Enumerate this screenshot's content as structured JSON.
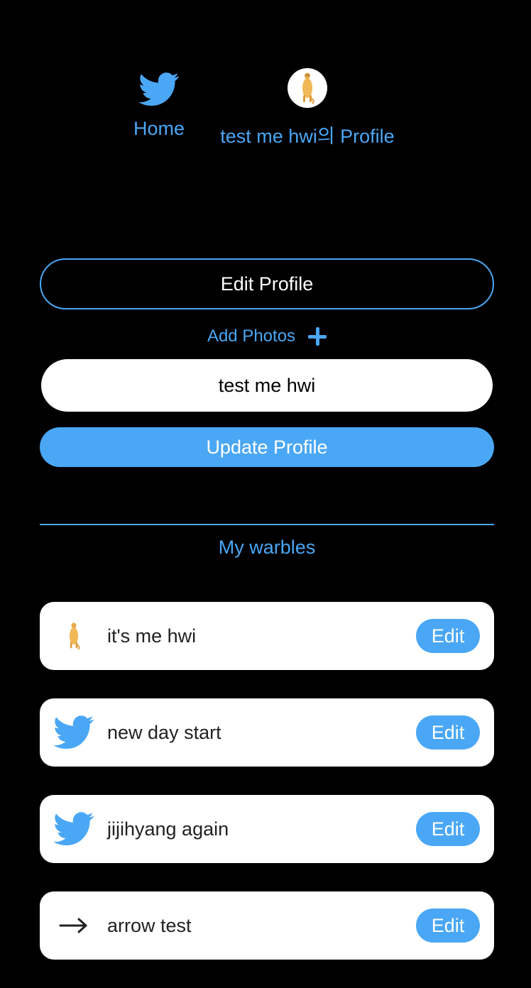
{
  "nav": {
    "home_label": "Home",
    "home_icon": "twitter-bird-icon",
    "profile_label": "test me hwi의 Profile",
    "profile_icon": "user-avatar"
  },
  "profile_form": {
    "edit_profile_label": "Edit Profile",
    "add_photos_label": "Add Photos",
    "add_photos_icon": "plus-icon",
    "display_name_value": "test me hwi",
    "update_button_label": "Update Profile"
  },
  "section": {
    "title": "My warbles"
  },
  "warbles": [
    {
      "text": "it's me hwi",
      "icon": "meerkat-image",
      "edit_label": "Edit"
    },
    {
      "text": "new day start",
      "icon": "twitter-bird-icon",
      "edit_label": "Edit"
    },
    {
      "text": "jijihyang again",
      "icon": "twitter-bird-icon",
      "edit_label": "Edit"
    },
    {
      "text": "arrow test",
      "icon": "arrow-right-icon",
      "edit_label": "Edit"
    }
  ],
  "colors": {
    "accent": "#4aa7f5",
    "background": "#000000",
    "card": "#ffffff"
  }
}
